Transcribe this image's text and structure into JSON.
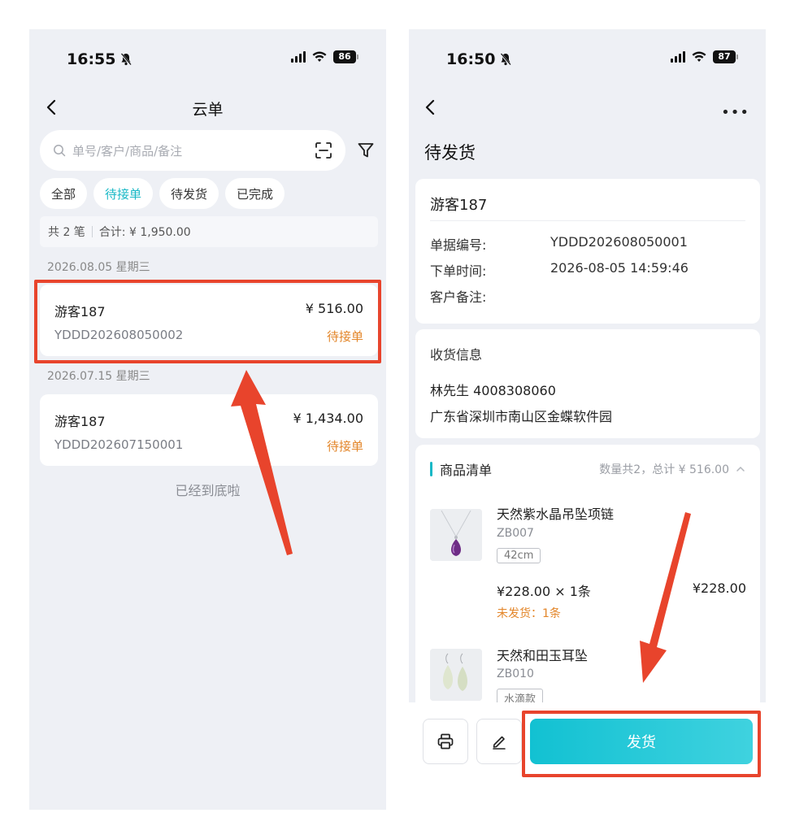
{
  "left": {
    "status": {
      "time": "16:55",
      "battery": "86"
    },
    "nav": {
      "title": "云单"
    },
    "search": {
      "placeholder": "单号/客户/商品/备注"
    },
    "tabs": [
      {
        "label": "全部",
        "active": false
      },
      {
        "label": "待接单",
        "active": true
      },
      {
        "label": "待发货",
        "active": false
      },
      {
        "label": "已完成",
        "active": false
      }
    ],
    "summary": {
      "count": "共 2 笔",
      "total": "合计: ¥ 1,950.00"
    },
    "groups": [
      {
        "date": "2026.08.05 星期三",
        "order": {
          "customer": "游客187",
          "amount": "¥ 516.00",
          "number": "YDDD202608050002",
          "status": "待接单"
        }
      },
      {
        "date": "2026.07.15 星期三",
        "order": {
          "customer": "游客187",
          "amount": "¥ 1,434.00",
          "number": "YDDD202607150001",
          "status": "待接单"
        }
      }
    ],
    "end_text": "已经到底啦"
  },
  "right": {
    "status": {
      "time": "16:50",
      "battery": "87"
    },
    "page_title": "待发货",
    "order": {
      "customer": "游客187",
      "number_label": "单据编号:",
      "number": "YDDD202608050001",
      "time_label": "下单时间:",
      "time": "2026-08-05 14:59:46",
      "remark_label": "客户备注:"
    },
    "shipping": {
      "title": "收货信息",
      "contact": "林先生 4008308060",
      "address": "广东省深圳市南山区金蝶软件园"
    },
    "goods": {
      "title": "商品清单",
      "summary": "数量共2，总计 ¥ 516.00",
      "items": [
        {
          "name": "天然紫水晶吊坠项链",
          "code": "ZB007",
          "spec": "42cm",
          "price": "¥228.00 × 1条",
          "total": "¥228.00",
          "unshipped": "未发货：1条"
        },
        {
          "name": "天然和田玉耳坠",
          "code": "ZB010",
          "spec": "水滴款"
        }
      ]
    },
    "ship_button": "发货"
  },
  "colors": {
    "accent": "#19b8c6",
    "warning": "#e3862a",
    "highlight": "#e8442c"
  }
}
